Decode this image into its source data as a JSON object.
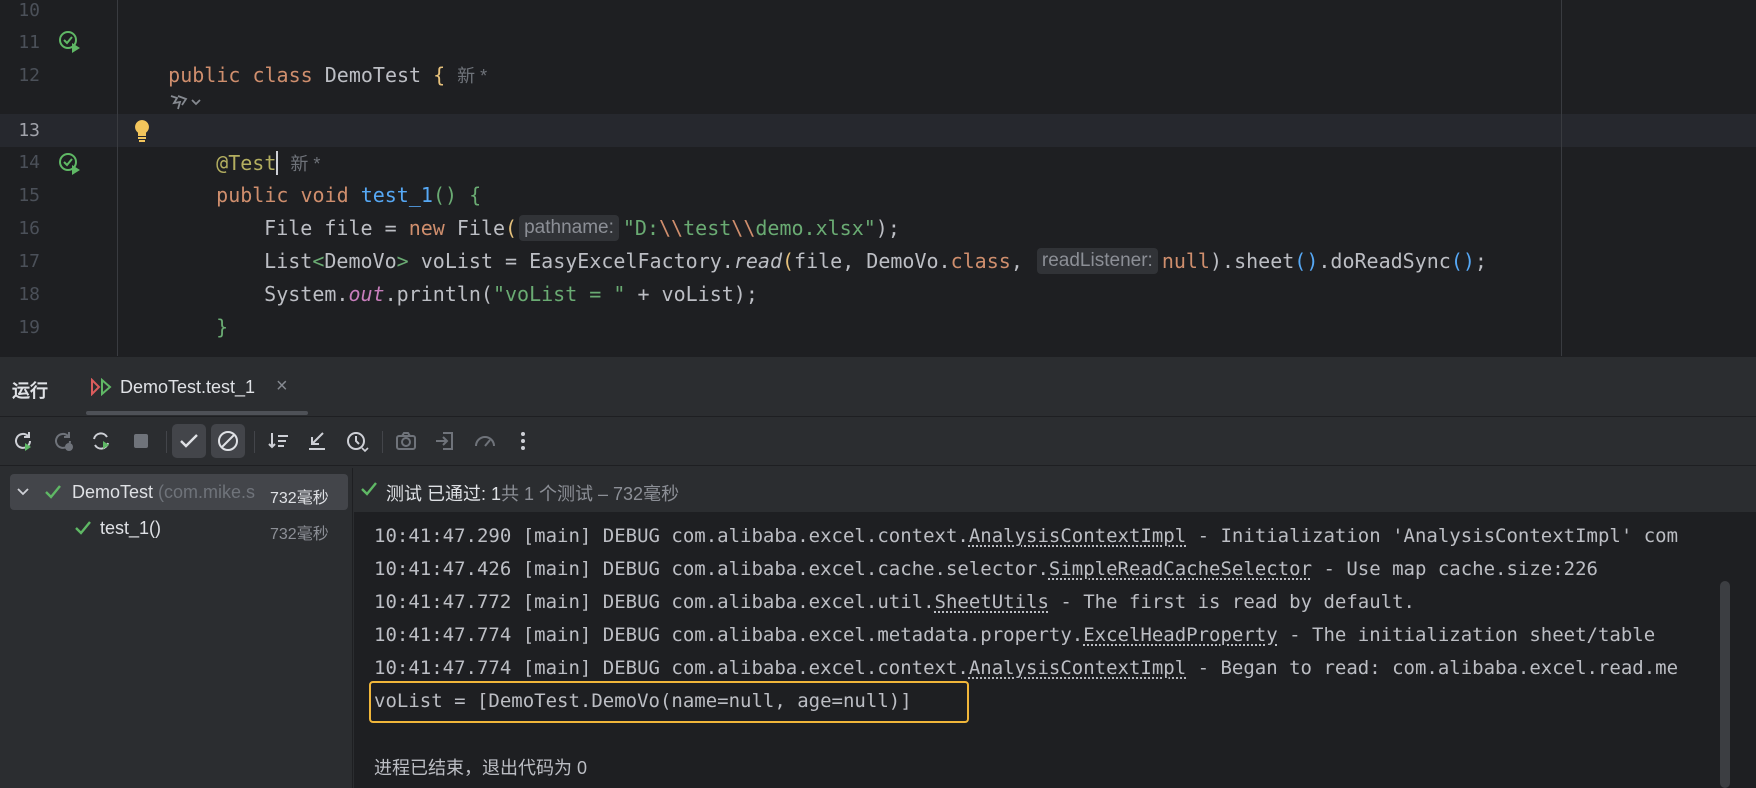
{
  "editor": {
    "gutter": [
      "10",
      "11",
      "12",
      "13",
      "14",
      "15",
      "16",
      "17",
      "18",
      "19"
    ],
    "new_mark": "新 *",
    "lines": {
      "l11": {
        "kw1": "public",
        "kw2": "class",
        "name": "DemoTest",
        "brace": "{"
      },
      "l13": {
        "annotation": "@Test"
      },
      "l14": {
        "kw1": "public",
        "kw2": "void",
        "method": "test_1",
        "parens": "()",
        "brace": "{"
      },
      "l15": {
        "type": "File",
        "var": "file",
        "eq": "=",
        "kw_new": "new",
        "ctor": "File",
        "open": "(",
        "hint": "pathname:",
        "str_a": "\"D:",
        "esc1": "\\\\",
        "str_b": "test",
        "esc2": "\\\\",
        "str_c": "demo.xlsx\"",
        "close": ");"
      },
      "l16": {
        "type": "List",
        "lt": "<",
        "generic": "DemoVo",
        "gt": ">",
        "var": "voList",
        "eq": "=",
        "factory": "EasyExcelFactory.",
        "read": "read",
        "open": "(",
        "args": "file, DemoVo.",
        "cls": "class",
        "comma": ",",
        "hint": "readListener:",
        "null": "null",
        "tail1": ").sheet",
        "p1": "()",
        "tail2": ".doReadSync",
        "p2": "()",
        "semi": ";"
      },
      "l17": {
        "sys": "System.",
        "out": "out",
        "print": ".println(",
        "str": "\"voList = \"",
        "rest": " + voList);"
      },
      "l18": {
        "brace": "}"
      }
    }
  },
  "run": {
    "title": "运行",
    "tab_label": "DemoTest.test_1",
    "close": "×",
    "tree": {
      "root_label": "DemoTest",
      "root_pkg": "(com.mike.s",
      "root_time": "732毫秒",
      "child_label": "test_1()",
      "child_time": "732毫秒"
    },
    "status": {
      "main": "测试 已通过: 1",
      "sub": "共 1 个测试 – 732毫秒"
    },
    "log": [
      {
        "prefix": "10:41:47.290 [main] DEBUG com.alibaba.excel.context.",
        "link": "AnalysisContextImpl",
        "suffix": " - Initialization 'AnalysisContextImpl' com"
      },
      {
        "prefix": "10:41:47.426 [main] DEBUG com.alibaba.excel.cache.selector.",
        "link": "SimpleReadCacheSelector",
        "suffix": " - Use map cache.size:226"
      },
      {
        "prefix": "10:41:47.772 [main] DEBUG com.alibaba.excel.util.",
        "link": "SheetUtils",
        "suffix": " - The first is read by default."
      },
      {
        "prefix": "10:41:47.774 [main] DEBUG com.alibaba.excel.metadata.property.",
        "link": "ExcelHeadProperty",
        "suffix": " - The initialization sheet/table"
      },
      {
        "prefix": "10:41:47.774 [main] DEBUG com.alibaba.excel.context.",
        "link": "AnalysisContextImpl",
        "suffix": " - Began to read: com.alibaba.excel.read.me"
      }
    ],
    "output": "voList = [DemoTest.DemoVo(name=null, age=null)]",
    "exit": "进程已结束，退出代码为 0"
  },
  "colors": {
    "accent_highlight": "#f0b63a",
    "success": "#5fb865",
    "editor_bg": "#1e1f22",
    "panel_bg": "#2b2d30"
  },
  "icons": [
    "run-test-icon",
    "bulb-icon",
    "ai-assist-icon",
    "rerun-icon",
    "rerun-failed-icon",
    "toggle-auto-rerun-icon",
    "stop-icon",
    "show-passed-icon",
    "show-ignored-icon",
    "sort-icon",
    "collapse-icon",
    "history-icon",
    "camera-icon",
    "export-icon",
    "coverage-icon",
    "more-icon",
    "check-icon"
  ]
}
